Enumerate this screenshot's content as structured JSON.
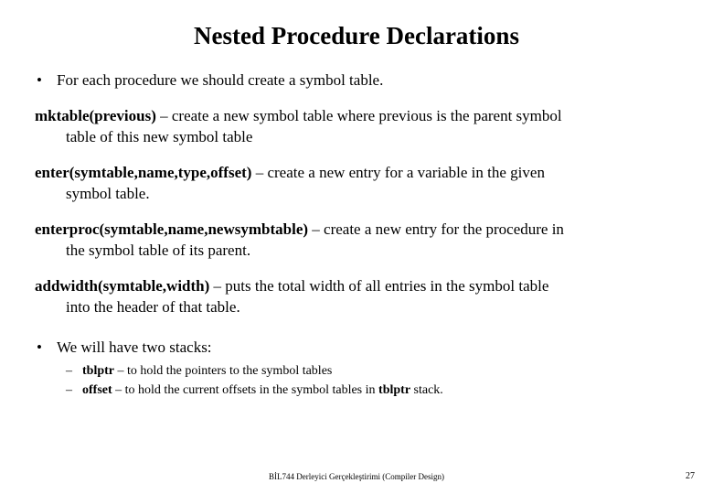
{
  "title": "Nested Procedure Declarations",
  "bullets": {
    "b1": "For each procedure we should create a symbol table.",
    "b2": "We will have two stacks:"
  },
  "funcs": {
    "mktable_sig": "mktable(previous)",
    "mktable_txt1": " – create a new symbol table where previous is the parent symbol",
    "mktable_txt2": "table of this new symbol table",
    "enter_sig": "enter(symtable,name,type,offset)",
    "enter_txt1": " – create a new entry for a variable in the given",
    "enter_txt2": "symbol table.",
    "enterproc_sig": "enterproc(symtable,name,newsymbtable)",
    "enterproc_txt1": " – create a new entry for the procedure in",
    "enterproc_txt2": "the symbol table of its parent.",
    "addwidth_sig": "addwidth(symtable,width)",
    "addwidth_txt1": " – puts the total width of all entries in the symbol table",
    "addwidth_txt2": "into the header of that table."
  },
  "sub": {
    "s1a": "tblptr",
    "s1b": " – to hold the pointers to the symbol tables",
    "s2a": "offset",
    "s2b": " – to hold the current offsets in the symbol tables in ",
    "s2c": "tblptr",
    "s2d": " stack."
  },
  "footer": "BİL744 Derleyici Gerçekleştirimi (Compiler Design)",
  "page": "27"
}
